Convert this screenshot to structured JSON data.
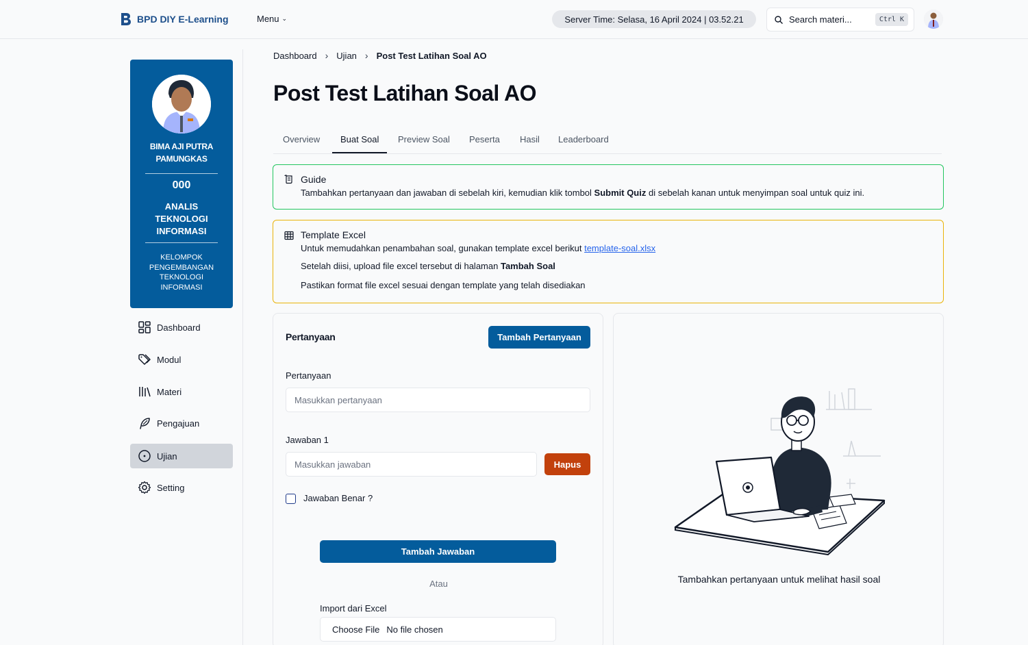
{
  "header": {
    "brand": "BPD DIY E-Learning",
    "menu_label": "Menu",
    "server_time": "Server Time: Selasa, 16 April 2024 | 03.52.21",
    "search_placeholder": "Search materi...",
    "search_shortcut": "Ctrl K"
  },
  "profile": {
    "name": "BIMA AJI PUTRA PAMUNGKAS",
    "nip": "000",
    "role": "ANALIS TEKNOLOGI INFORMASI",
    "unit": "KELOMPOK PENGEMBANGAN TEKNOLOGI INFORMASI"
  },
  "sidebar": {
    "items": [
      {
        "label": "Dashboard",
        "icon": "dashboard-icon"
      },
      {
        "label": "Modul",
        "icon": "tag-icon"
      },
      {
        "label": "Materi",
        "icon": "library-icon"
      },
      {
        "label": "Pengajuan",
        "icon": "feather-icon"
      },
      {
        "label": "Ujian",
        "icon": "target-icon",
        "active": true
      },
      {
        "label": "Setting",
        "icon": "gear-icon"
      }
    ]
  },
  "breadcrumb": [
    "Dashboard",
    "Ujian",
    "Post Test Latihan Soal AO"
  ],
  "page_title": "Post Test Latihan Soal AO",
  "tabs": [
    "Overview",
    "Buat Soal",
    "Preview Soal",
    "Peserta",
    "Hasil",
    "Leaderboard"
  ],
  "active_tab": "Buat Soal",
  "guide": {
    "title": "Guide",
    "text_before": "Tambahkan pertanyaan dan jawaban di sebelah kiri, kemudian klik tombol ",
    "text_bold": "Submit Quiz",
    "text_after": " di sebelah kanan untuk menyimpan soal untuk quiz ini."
  },
  "template_excel": {
    "title": "Template Excel",
    "line1": "Untuk memudahkan penambahan soal, gunakan template excel berikut ",
    "link": "template-soal.xlsx",
    "line2_before": "Setelah diisi, upload file excel tersebut di halaman ",
    "line2_bold": "Tambah Soal",
    "line3": "Pastikan format file excel sesuai dengan template yang telah disediakan"
  },
  "form": {
    "heading": "Pertanyaan",
    "add_question_button": "Tambah Pertanyaan",
    "question_label": "Pertanyaan",
    "question_placeholder": "Masukkan pertanyaan",
    "answer_label": "Jawaban 1",
    "answer_placeholder": "Masukkan jawaban",
    "delete_button": "Hapus",
    "correct_label": "Jawaban Benar ?",
    "add_answer_button": "Tambah Jawaban",
    "or_text": "Atau",
    "import_label": "Import dari Excel",
    "choose_file": "Choose File",
    "no_file": "No file chosen"
  },
  "preview": {
    "empty_text": "Tambahkan pertanyaan untuk melihat hasil soal"
  },
  "colors": {
    "brand": "#045c9c",
    "guide_border": "#22c55e",
    "excel_border": "#eab308",
    "danger": "#c2410c"
  }
}
